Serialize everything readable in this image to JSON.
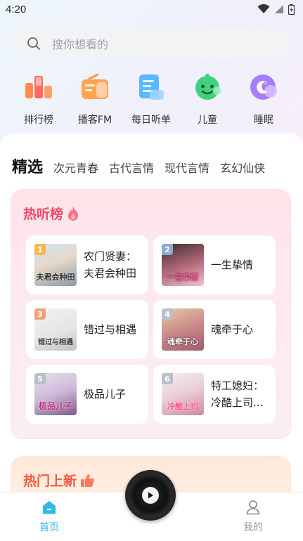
{
  "status_bar": {
    "time": "4:20"
  },
  "search": {
    "placeholder": "搜你想看的"
  },
  "quick_nav": [
    {
      "label": "排行榜",
      "icon": "ranking-icon"
    },
    {
      "label": "播客FM",
      "icon": "radio-icon"
    },
    {
      "label": "每日听单",
      "icon": "daily-list-icon"
    },
    {
      "label": "儿童",
      "icon": "kids-icon"
    },
    {
      "label": "睡眠",
      "icon": "sleep-icon"
    }
  ],
  "tabs": [
    "精选",
    "次元青春",
    "古代言情",
    "现代言情",
    "玄幻仙侠"
  ],
  "hot_list": {
    "title": "热听榜",
    "books": [
      {
        "rank": "1",
        "title": "农门贤妻：夫君会种田",
        "cover_text": "夫君会种田"
      },
      {
        "rank": "2",
        "title": "一生挚情",
        "cover_text": "一生挚情"
      },
      {
        "rank": "3",
        "title": "错过与相遇",
        "cover_text": "错过与相遇"
      },
      {
        "rank": "4",
        "title": "魂牵于心",
        "cover_text": "魂牵于心"
      },
      {
        "rank": "5",
        "title": "极品儿子",
        "cover_text": "极品儿子"
      },
      {
        "rank": "6",
        "title": "特工媳妇：冷酷上司...",
        "cover_text": "冷酷上司"
      }
    ]
  },
  "new_list": {
    "title": "热门上新"
  },
  "bottom_nav": {
    "home_label": "首页",
    "mine_label": "我的"
  },
  "colors": {
    "accent": "#33b6e9",
    "hot_title": "#f04a6e",
    "new_title": "#f2593b"
  }
}
